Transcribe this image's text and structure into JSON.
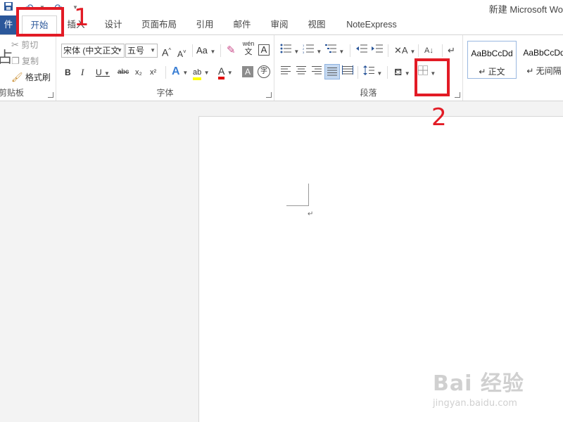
{
  "window": {
    "title": "新建 Microsoft Wo"
  },
  "quick_access": {
    "save_icon": "save-icon",
    "undo_icon": "undo-icon",
    "redo_icon": "redo-icon",
    "customize": "▼"
  },
  "tabs": [
    {
      "label": "件"
    },
    {
      "label": "开始"
    },
    {
      "label": "插入"
    },
    {
      "label": "设计"
    },
    {
      "label": "页面布局"
    },
    {
      "label": "引用"
    },
    {
      "label": "邮件"
    },
    {
      "label": "审阅"
    },
    {
      "label": "视图"
    },
    {
      "label": "NoteExpress"
    }
  ],
  "clipboard": {
    "paste_glyph": "占",
    "cut_label": "剪切",
    "copy_label": "复制",
    "painter_label": "格式刷",
    "group_label": "剪贴板"
  },
  "font": {
    "font_name": "宋体 (中文正文",
    "font_size": "五号",
    "grow_glyph": "A",
    "shrink_glyph": "A",
    "case_glyph": "Aa",
    "pinyin_top": "wén",
    "pinyin_bottom": "文",
    "border_glyph": "A",
    "bold": "B",
    "italic": "I",
    "underline": "U",
    "strike": "abc",
    "subscript": "x₂",
    "superscript": "x²",
    "effects": "A",
    "highlight": "ab",
    "color": "A",
    "shade": "A",
    "enclose": "字",
    "group_label": "字体"
  },
  "paragraph": {
    "group_label": "段落",
    "sort_glyph": "A↓",
    "marks_glyph": "↵"
  },
  "styles": [
    {
      "sample": "AaBbCcDd",
      "name": "↵ 正文"
    },
    {
      "sample": "AaBbCcDd",
      "name": "↵ 无间隔"
    }
  ],
  "document": {
    "para_mark": "↵"
  },
  "annotations": {
    "one": "1",
    "two": "2"
  },
  "watermark": {
    "main": "Bai 经验",
    "url": "jingyan.baidu.com"
  },
  "colors": {
    "accent": "#2b579a",
    "annotation": "#e21b25",
    "highlight": "#ffff00",
    "font_color": "#e00000"
  }
}
